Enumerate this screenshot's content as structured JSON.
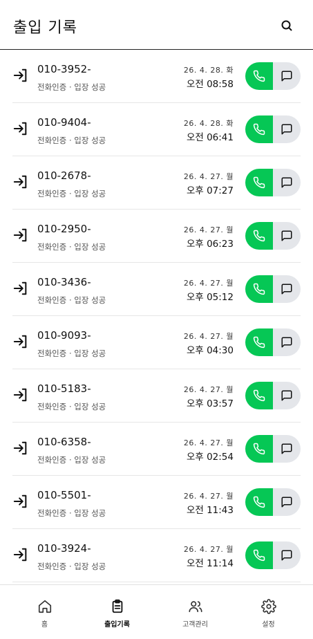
{
  "header": {
    "title": "출입 기록"
  },
  "records": [
    {
      "phone": "010-3952-",
      "sub": "전화인증 · 입장 성공",
      "date": "26. 4. 28. 화",
      "time": "오전 08:58"
    },
    {
      "phone": "010-9404-",
      "sub": "전화인증 · 입장 성공",
      "date": "26. 4. 28. 화",
      "time": "오전 06:41"
    },
    {
      "phone": "010-2678-",
      "sub": "전화인증 · 입장 성공",
      "date": "26. 4. 27. 월",
      "time": "오후 07:27"
    },
    {
      "phone": "010-2950-",
      "sub": "전화인증 · 입장 성공",
      "date": "26. 4. 27. 월",
      "time": "오후 06:23"
    },
    {
      "phone": "010-3436-",
      "sub": "전화인증 · 입장 성공",
      "date": "26. 4. 27. 월",
      "time": "오후 05:12"
    },
    {
      "phone": "010-9093-",
      "sub": "전화인증 · 입장 성공",
      "date": "26. 4. 27. 월",
      "time": "오후 04:30"
    },
    {
      "phone": "010-5183-",
      "sub": "전화인증 · 입장 성공",
      "date": "26. 4. 27. 월",
      "time": "오후 03:57"
    },
    {
      "phone": "010-6358-",
      "sub": "전화인증 · 입장 성공",
      "date": "26. 4. 27. 월",
      "time": "오후 02:54"
    },
    {
      "phone": "010-5501-",
      "sub": "전화인증 · 입장 성공",
      "date": "26. 4. 27. 월",
      "time": "오전 11:43"
    },
    {
      "phone": "010-3924-",
      "sub": "전화인증 · 입장 성공",
      "date": "26. 4. 27. 월",
      "time": "오전 11:14"
    }
  ],
  "nav": [
    {
      "label": "홈",
      "icon": "home-icon",
      "active": false
    },
    {
      "label": "출입기록",
      "icon": "clipboard-icon",
      "active": true
    },
    {
      "label": "고객관리",
      "icon": "users-icon",
      "active": false
    },
    {
      "label": "설정",
      "icon": "gear-icon",
      "active": false
    }
  ],
  "colors": {
    "call": "#06c755",
    "message": "#e4e6ea"
  }
}
